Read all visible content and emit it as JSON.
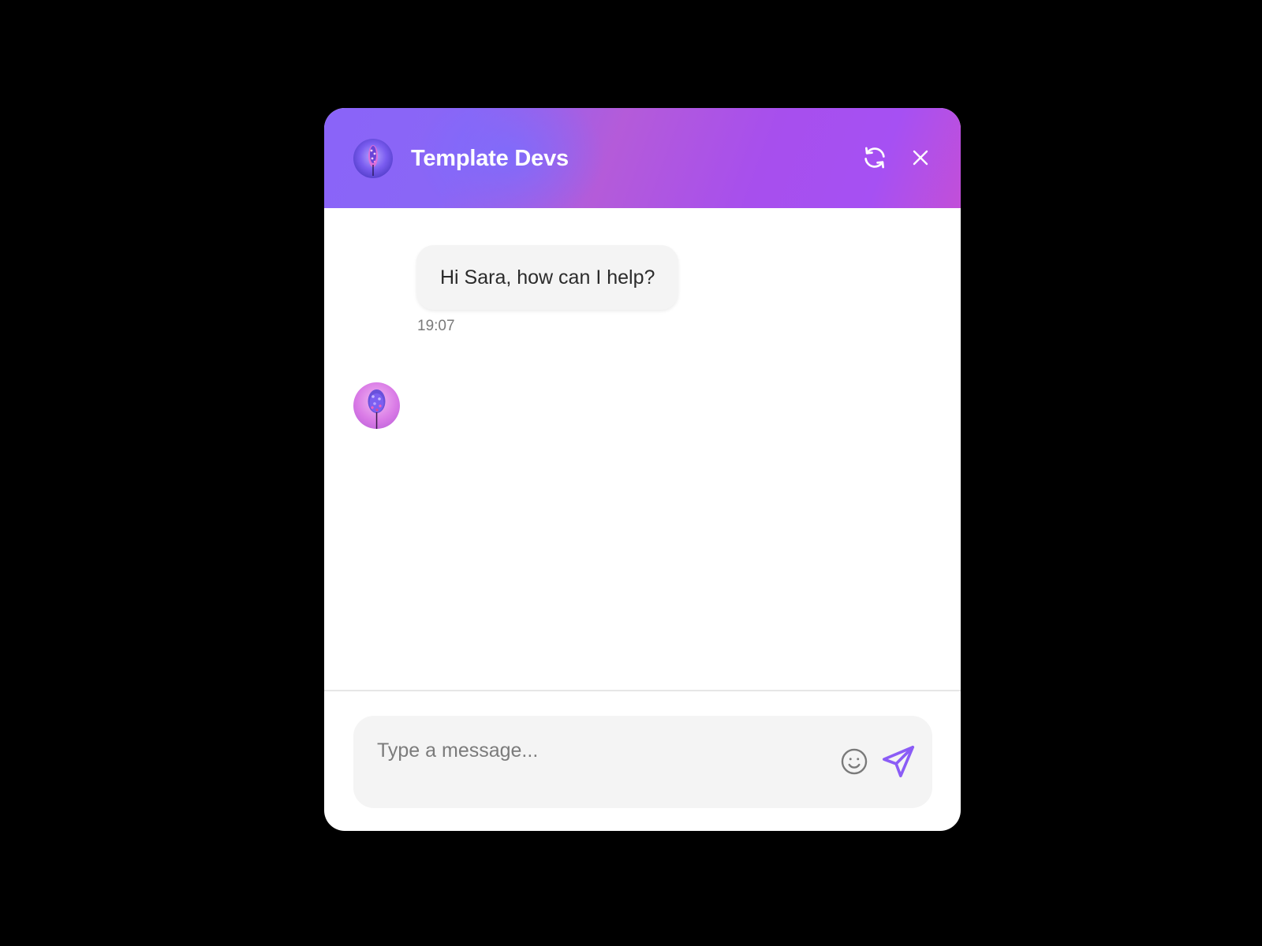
{
  "colors": {
    "page_background": "#000000",
    "header_gradient": [
      "#8a64f8",
      "#b45bd9",
      "#a650f3",
      "#c24fd8"
    ],
    "accent": "#8b5cf6",
    "bubble_background": "#f4f4f4",
    "composer_background": "#f4f4f4"
  },
  "header": {
    "avatar_icon": "tree-avatar",
    "title": "Template Devs",
    "refresh_icon": "refresh-icon",
    "close_icon": "close-icon"
  },
  "messages": [
    {
      "sender": "bot",
      "avatar_icon": "tree-avatar",
      "text": "Hi Sara, how can I help?",
      "time": "19:07"
    }
  ],
  "composer": {
    "placeholder": "Type a message...",
    "value": "",
    "emoji_icon": "smiley-icon",
    "send_icon": "send-icon"
  }
}
